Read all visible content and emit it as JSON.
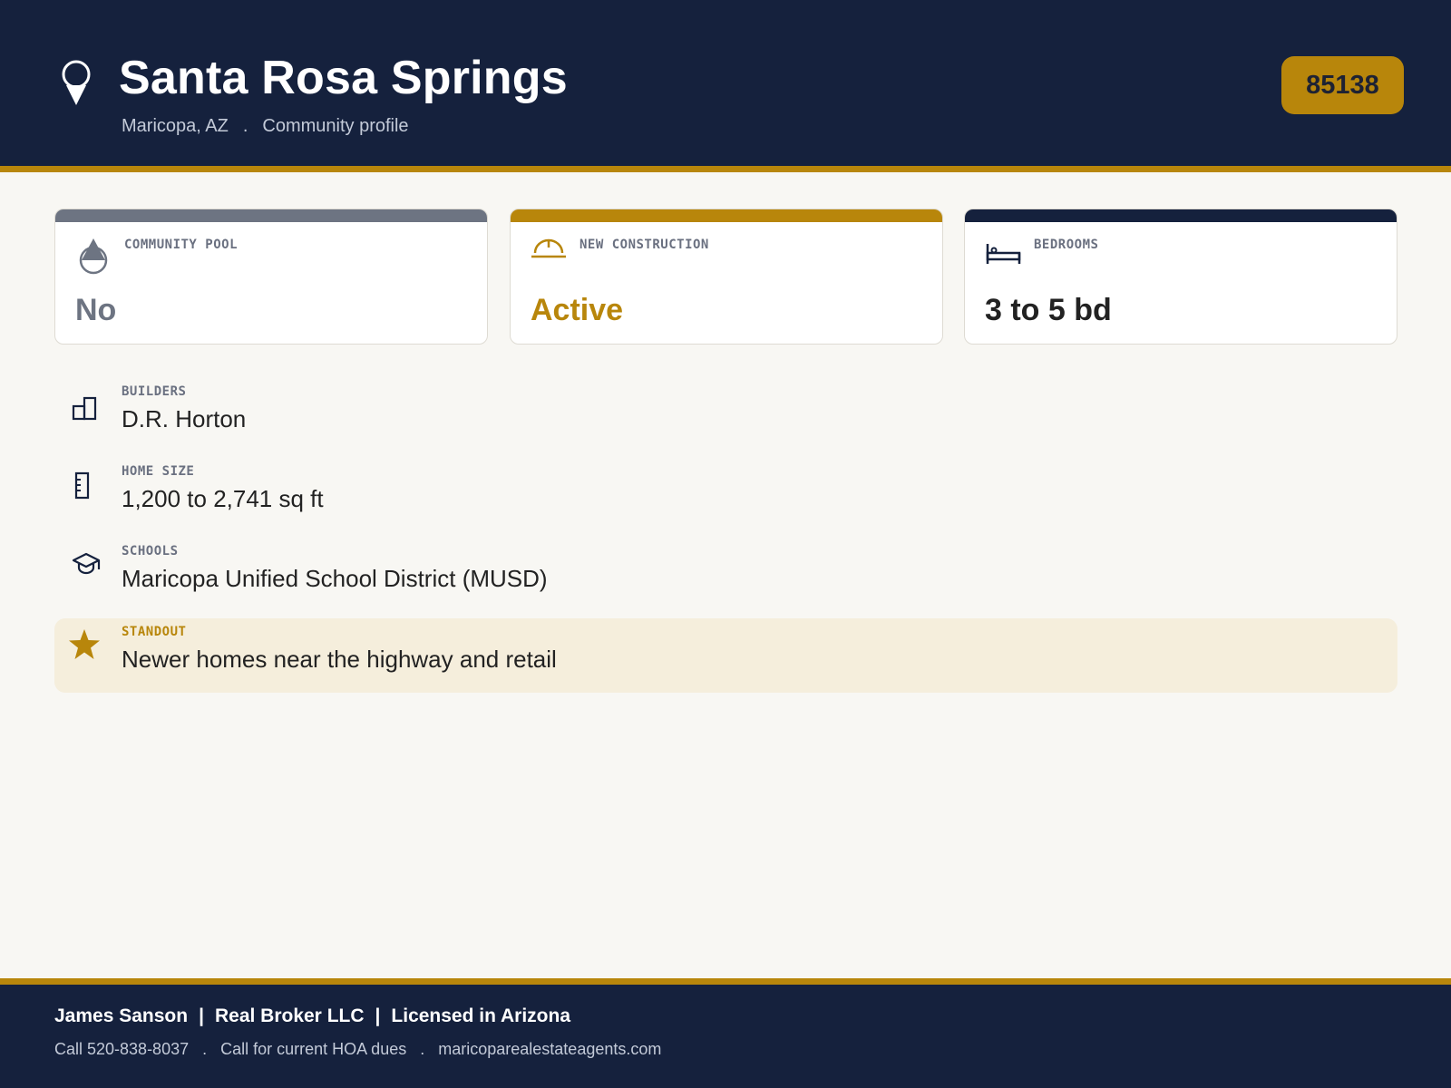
{
  "header": {
    "title": "Santa Rosa Springs",
    "location": "Maricopa, AZ",
    "separator": ".",
    "page_type": "Community profile",
    "zip_code": "85138",
    "icon": "map-pin-icon"
  },
  "cards": {
    "pool": {
      "label": "COMMUNITY POOL",
      "value": "No",
      "icon": "water-drop-icon"
    },
    "construction": {
      "label": "NEW CONSTRUCTION",
      "value": "Active",
      "icon": "hard-hat-icon"
    },
    "bedrooms": {
      "label": "BEDROOMS",
      "value": "3 to 5 bd",
      "icon": "bed-icon"
    }
  },
  "details": {
    "builders": {
      "label": "BUILDERS",
      "value": "D.R. Horton",
      "icon": "buildings-icon"
    },
    "home_size": {
      "label": "HOME SIZE",
      "value": "1,200 to 2,741 sq ft",
      "icon": "ruler-icon"
    },
    "schools": {
      "label": "SCHOOLS",
      "value": "Maricopa Unified School District (MUSD)",
      "icon": "graduation-cap-icon"
    }
  },
  "standout": {
    "label": "STANDOUT",
    "value": "Newer homes near the highway and retail",
    "icon": "star-icon"
  },
  "footer": {
    "agent": "James Sanson",
    "pipe": "|",
    "brokerage": "Real Broker LLC",
    "license": "Licensed in Arizona",
    "separator": ".",
    "phone": "Call 520-838-8037",
    "hoa_note": "Call for current HOA dues",
    "website": "maricoparealestateagents.com"
  },
  "colors": {
    "navy": "#15213d",
    "gold": "#b8860b",
    "slate": "#6d7482",
    "background": "#f8f7f3",
    "standout_bg": "#f5eedc"
  }
}
